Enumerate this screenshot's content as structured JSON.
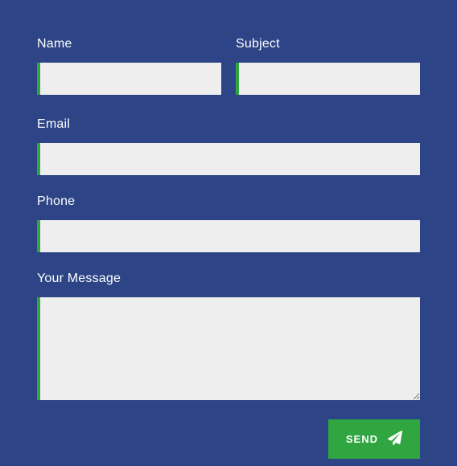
{
  "form": {
    "name": {
      "label": "Name",
      "value": ""
    },
    "subject": {
      "label": "Subject",
      "value": ""
    },
    "email": {
      "label": "Email",
      "value": ""
    },
    "phone": {
      "label": "Phone",
      "value": ""
    },
    "message": {
      "label": "Your Message",
      "value": ""
    },
    "submit_label": "SEND"
  },
  "colors": {
    "background": "#2d4587",
    "accent": "#2fa63f",
    "input_bg": "#eeeeee"
  }
}
